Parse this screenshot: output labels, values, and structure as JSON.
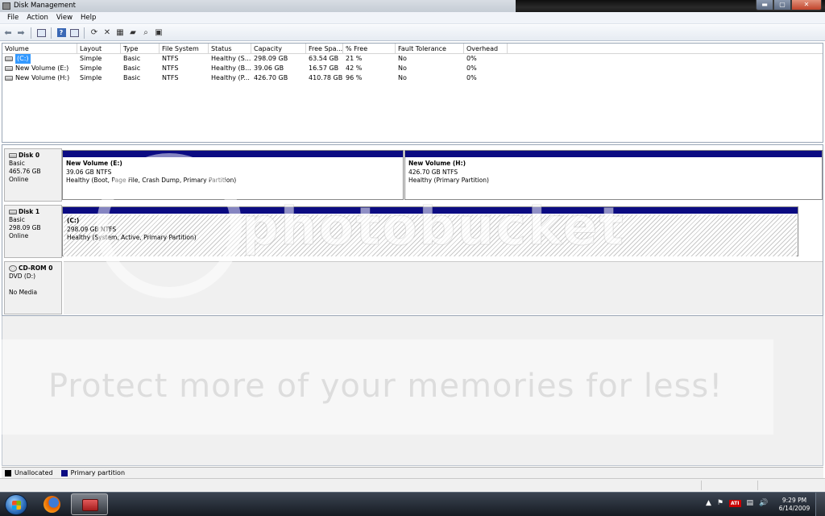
{
  "window": {
    "title": "Disk Management"
  },
  "menu": [
    "File",
    "Action",
    "View",
    "Help"
  ],
  "volume_list": {
    "columns": [
      "Volume",
      "Layout",
      "Type",
      "File System",
      "Status",
      "Capacity",
      "Free Spa...",
      "% Free",
      "Fault Tolerance",
      "Overhead"
    ],
    "rows": [
      [
        "(C:)",
        "Simple",
        "Basic",
        "NTFS",
        "Healthy (S...",
        "298.09 GB",
        "63.54 GB",
        "21 %",
        "No",
        "0%"
      ],
      [
        "New Volume (E:)",
        "Simple",
        "Basic",
        "NTFS",
        "Healthy (B...",
        "39.06 GB",
        "16.57 GB",
        "42 %",
        "No",
        "0%"
      ],
      [
        "New Volume (H:)",
        "Simple",
        "Basic",
        "NTFS",
        "Healthy (P...",
        "426.70 GB",
        "410.78 GB",
        "96 %",
        "No",
        "0%"
      ]
    ]
  },
  "disks": {
    "disk0": {
      "name": "Disk 0",
      "type": "Basic",
      "size": "465.76 GB",
      "state": "Online",
      "partitions": [
        {
          "name": "New Volume  (E:)",
          "size": "39.06 GB NTFS",
          "status": "Healthy (Boot, Page File, Crash Dump, Primary Partition)"
        },
        {
          "name": "New Volume  (H:)",
          "size": "426.70 GB NTFS",
          "status": "Healthy (Primary Partition)"
        }
      ]
    },
    "disk1": {
      "name": "Disk 1",
      "type": "Basic",
      "size": "298.09 GB",
      "state": "Online",
      "partitions": [
        {
          "name": "(C:)",
          "size": "298.09 GB NTFS",
          "status": "Healthy (System, Active, Primary Partition)"
        }
      ]
    },
    "cdrom0": {
      "name": "CD-ROM 0",
      "type": "DVD (D:)",
      "state": "No Media"
    }
  },
  "legend": {
    "unallocated": "Unallocated",
    "primary": "Primary partition"
  },
  "watermark": {
    "logo": "photobucket",
    "tagline": "Protect more of your memories for less!"
  },
  "taskbar": {
    "ati_label": "ATI",
    "time": "9:29 PM",
    "date": "6/14/2009"
  },
  "colors": {
    "primary_partition": "#0b0b82",
    "selection": "#3399ff"
  }
}
